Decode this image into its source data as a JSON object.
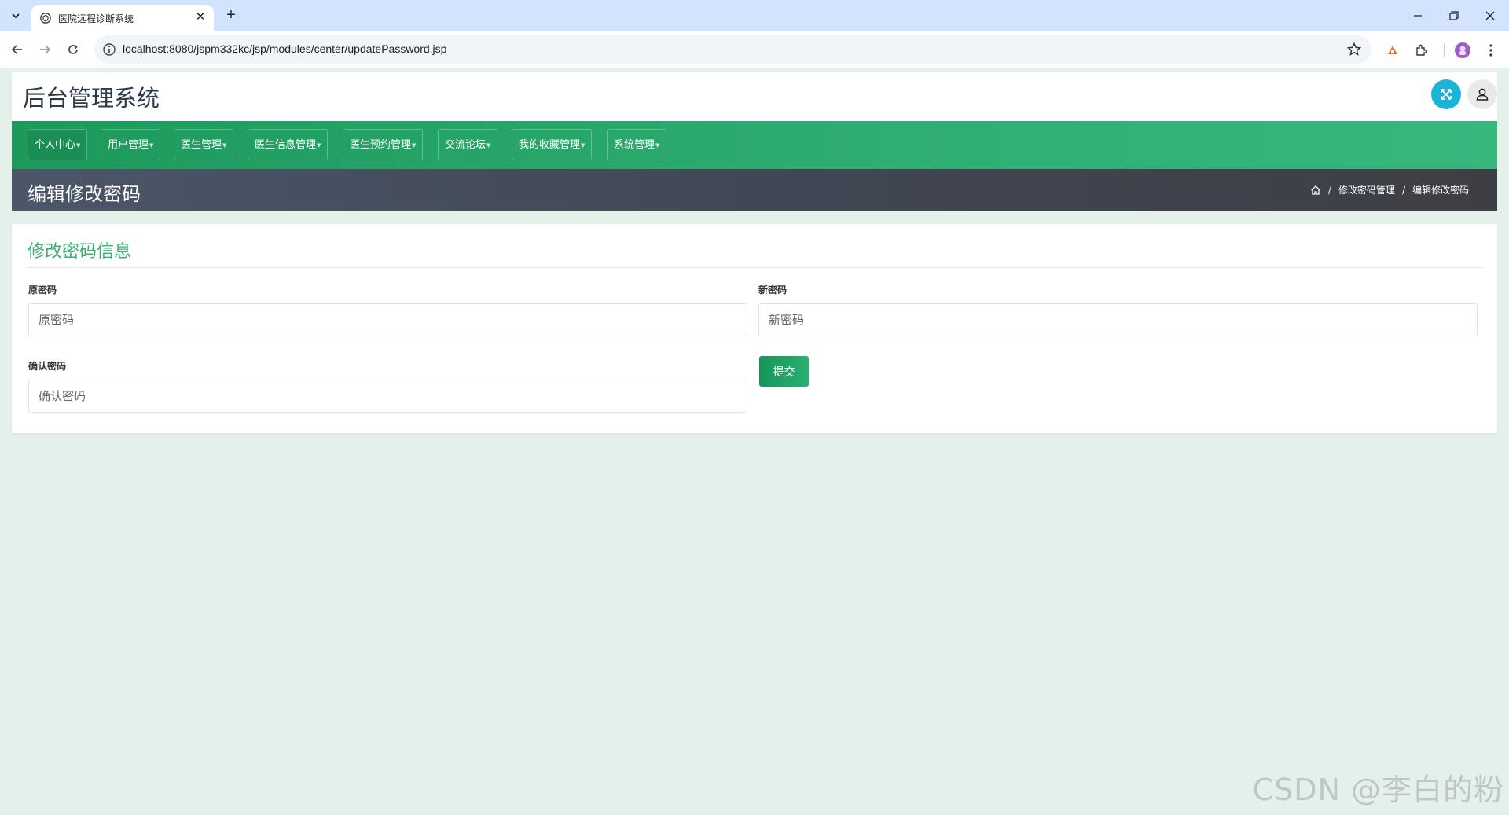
{
  "browser": {
    "tab_title": "医院远程诊断系统",
    "url": "localhost:8080/jspm332kc/jsp/modules/center/updatePassword.jsp"
  },
  "app": {
    "title": "后台管理系统"
  },
  "nav": {
    "items": [
      {
        "label": "个人中心",
        "has_dropdown": true
      },
      {
        "label": "用户管理",
        "has_dropdown": true
      },
      {
        "label": "医生管理",
        "has_dropdown": true
      },
      {
        "label": "医生信息管理",
        "has_dropdown": true
      },
      {
        "label": "医生预约管理",
        "has_dropdown": true
      },
      {
        "label": "交流论坛",
        "has_dropdown": true
      },
      {
        "label": "我的收藏管理",
        "has_dropdown": true
      },
      {
        "label": "系统管理",
        "has_dropdown": true
      }
    ]
  },
  "page": {
    "title": "编辑修改密码",
    "breadcrumb": [
      "修改密码管理",
      "编辑修改密码"
    ]
  },
  "form": {
    "section_title": "修改密码信息",
    "old_password": {
      "label": "原密码",
      "placeholder": "原密码",
      "value": ""
    },
    "new_password": {
      "label": "新密码",
      "placeholder": "新密码",
      "value": ""
    },
    "confirm_password": {
      "label": "确认密码",
      "placeholder": "确认密码",
      "value": ""
    },
    "submit_label": "提交"
  },
  "watermark": "CSDN @李白的粉",
  "colors": {
    "nav_green": "#1c9a5c",
    "title_green": "#3cae73",
    "page_bar": "#404653",
    "fullscreen_button": "#1bb3d8",
    "background": "#e4f1ea"
  }
}
